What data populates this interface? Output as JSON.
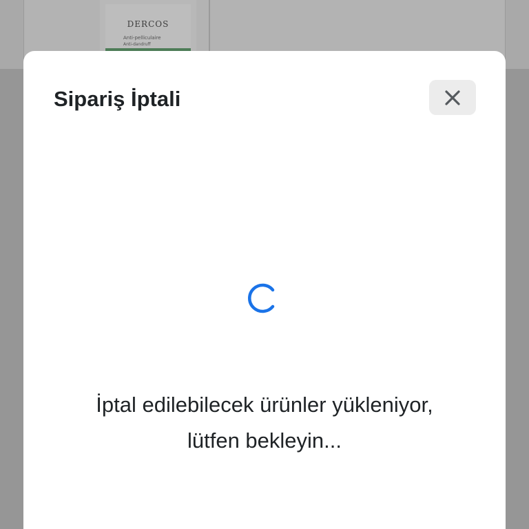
{
  "background": {
    "product": {
      "brand": "DERCOS",
      "line1": "Anti-pelliculaire",
      "line2": "Anti-dandruff"
    }
  },
  "modal": {
    "title": "Sipariş İptali",
    "close_icon": "close-icon",
    "spinner_color": "#1a73e8",
    "loading_line1": "İptal edilebilecek ürünler yükleniyor,",
    "loading_line2": "lütfen bekleyin..."
  }
}
